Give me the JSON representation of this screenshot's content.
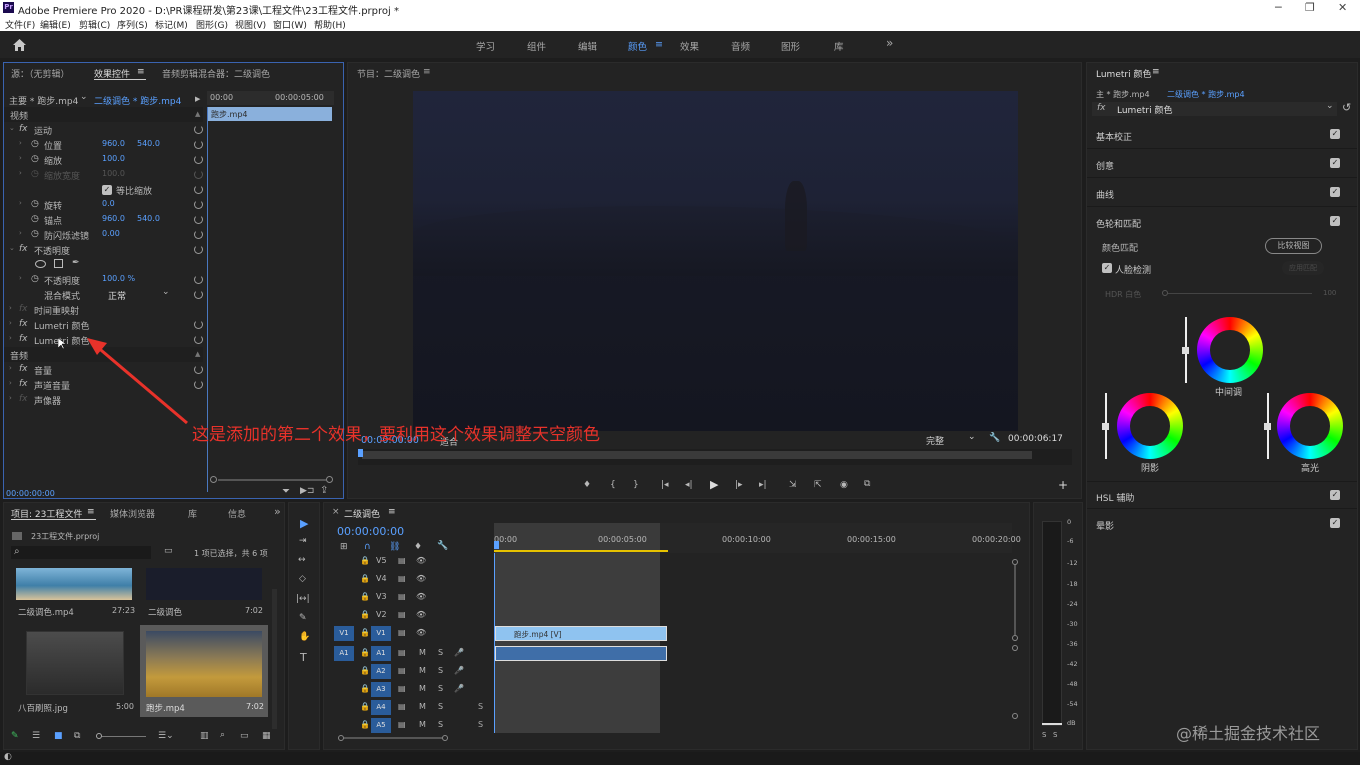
{
  "titlebar": {
    "app_icon": "Pr",
    "title": "Adobe Premiere Pro 2020 - D:\\PR课程研发\\第23课\\工程文件\\23工程文件.prproj *",
    "min": "─",
    "max": "❐",
    "close": "✕"
  },
  "menu": [
    "文件(F)",
    "编辑(E)",
    "剪辑(C)",
    "序列(S)",
    "标记(M)",
    "图形(G)",
    "视图(V)",
    "窗口(W)",
    "帮助(H)"
  ],
  "workspaces": {
    "items": [
      "学习",
      "组件",
      "编辑",
      "颜色",
      "效果",
      "音频",
      "图形",
      "库"
    ],
    "active": "颜色",
    "active_index": 3,
    "more": "»",
    "menu_icon": "≡"
  },
  "effect_controls": {
    "tabs": [
      "源：（无剪辑）",
      "效果控件",
      "音频剪辑混合器：二级调色"
    ],
    "tab_menu": "≡",
    "master": "主要 * 跑步.mp4",
    "master_arrow": "⌄",
    "seq": "二级调色 * 跑步.mp4",
    "play_icon": "▶",
    "ruler": [
      "00:00",
      "00:00:05:00"
    ],
    "clip": "跑步.mp4",
    "video_header": "视频",
    "fx": "fx",
    "motion": "运动",
    "position": {
      "label": "位置",
      "x": "960.0",
      "y": "540.0"
    },
    "scale": {
      "label": "缩放",
      "v": "100.0"
    },
    "scale_w": {
      "label": "缩放宽度",
      "v": "100.0"
    },
    "uniform": {
      "label": "等比缩放",
      "check": "✓"
    },
    "rotation": {
      "label": "旋转",
      "v": "0.0"
    },
    "anchor": {
      "label": "锚点",
      "x": "960.0",
      "y": "540.0"
    },
    "flicker": {
      "label": "防闪烁滤镜",
      "v": "0.00"
    },
    "opacity_group": "不透明度",
    "opacity": {
      "label": "不透明度",
      "v": "100.0 %"
    },
    "blend": {
      "label": "混合模式",
      "v": "正常",
      "arrow": "⌄"
    },
    "remap": "时间重映射",
    "lumetri1": "Lumetri 颜色",
    "lumetri2": "Lumetri 颜色",
    "audio_header": "音频",
    "volume": "音量",
    "channel_vol": "声道音量",
    "panner": "声像器",
    "timecode": "00:00:00:00",
    "filter_icon": "⏷"
  },
  "program": {
    "title": "节目：二级调色",
    "menu": "≡",
    "timecode": "00:00:00:00",
    "fit": "适合",
    "quality": "完整",
    "quality_arrow": "⌄",
    "duration": "00:00:06:17",
    "wrench": "🔧",
    "add": "+",
    "controls": [
      "♦",
      "{",
      "}",
      "|◂",
      "◂|",
      "▶",
      "|▸",
      "▸|",
      "⇲",
      "⇱",
      "◉",
      "⧉"
    ]
  },
  "annotation": {
    "text": "这是添加的第二个效果，要利用这个效果调整天空颜色",
    "color": "#e8322a"
  },
  "lumetri": {
    "title": "Lumetri 颜色",
    "menu": "≡",
    "master": "主 * 跑步.mp4",
    "seq": "二级调色 * 跑步.mp4",
    "fx": "fx",
    "effect": "Lumetri 颜色",
    "effect_arrow": "⌄",
    "sections": [
      "基本校正",
      "创意",
      "曲线",
      "色轮和匹配"
    ],
    "color_match": "颜色匹配",
    "compare": "比较视图",
    "face": "人脸检测",
    "apply_match": "应用匹配",
    "hdr": "HDR 白色",
    "hdr_max": "100",
    "wheels": {
      "mid": "中间调",
      "shadow": "阴影",
      "high": "高光"
    },
    "hsl": "HSL 辅助",
    "vignette": "晕影",
    "check": "✓",
    "reset": "↺"
  },
  "project": {
    "tabs": [
      "项目: 23工程文件",
      "媒体浏览器",
      "库",
      "信息"
    ],
    "menu": "≡",
    "more": "»",
    "file": "23工程文件.prproj",
    "search_icon": "⌕",
    "folder_icon": "▭",
    "selection": "1 项已选择，共 6 项",
    "items": [
      {
        "name": "二级调色.mp4",
        "dur": "27:23"
      },
      {
        "name": "二级调色",
        "dur": "7:02"
      },
      {
        "name": "八百刷照.jpg",
        "dur": "5:00"
      },
      {
        "name": "跑步.mp4",
        "dur": "7:02"
      }
    ]
  },
  "timeline": {
    "close": "×",
    "title": "二级调色",
    "menu": "≡",
    "timecode": "00:00:00:00",
    "ruler": [
      "00:00",
      "00:00:05:00",
      "00:00:10:00",
      "00:00:15:00",
      "00:00:20:00"
    ],
    "video_tracks": [
      "V5",
      "V4",
      "V3",
      "V2",
      "V1"
    ],
    "audio_tracks": [
      "A1",
      "A2",
      "A3",
      "A4",
      "A5"
    ],
    "src_v": "V1",
    "src_a": "A1",
    "clip_v": "跑步.mp4 [V]",
    "m": "M",
    "s": "S",
    "lock": "🔒",
    "eye": "👁",
    "film": "▤",
    "mic": "🎤",
    "solo": "S"
  },
  "meter": {
    "scale": [
      "0",
      "-6",
      "-12",
      "-18",
      "-24",
      "-30",
      "-36",
      "-42",
      "-48",
      "-54",
      "dB"
    ],
    "s1": "S",
    "s2": "S"
  },
  "tools": [
    "▶",
    "⇥",
    "↔",
    "◇",
    "|↔|",
    "✎",
    "✋",
    "T"
  ],
  "watermark": "@稀土掘金技术社区"
}
